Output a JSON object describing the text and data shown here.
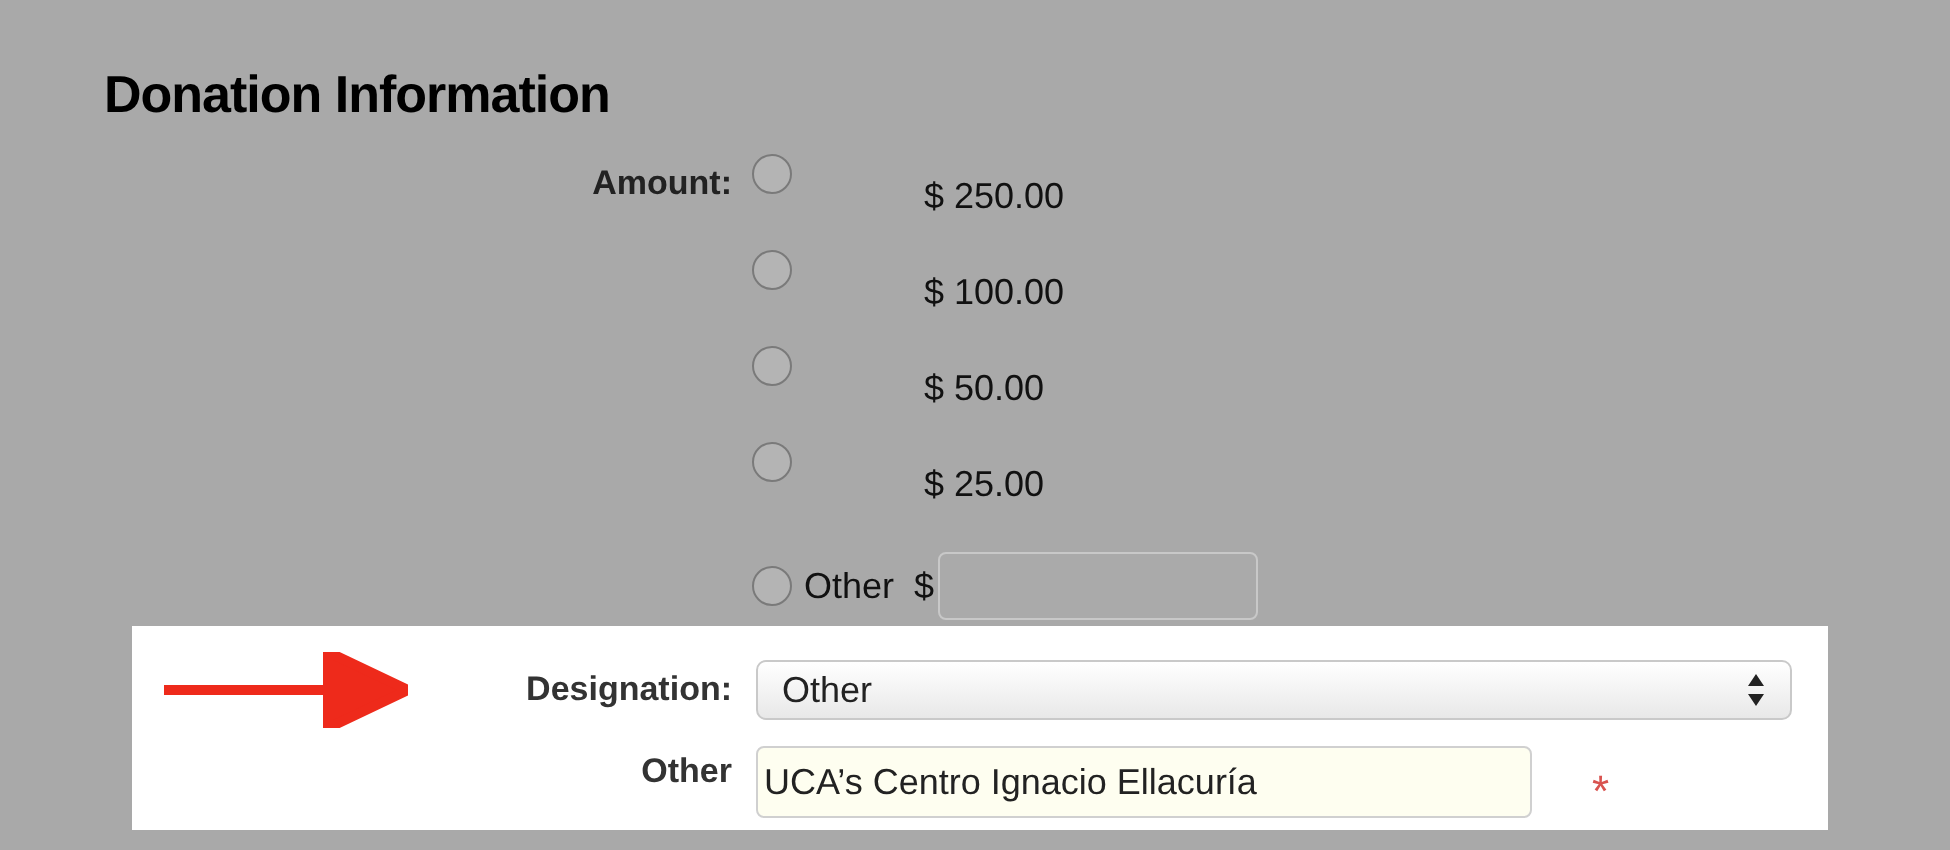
{
  "heading": "Donation Information",
  "amount": {
    "label": "Amount:",
    "options": [
      {
        "kind": "fixed",
        "label": "$ 250.00",
        "selected": false
      },
      {
        "kind": "fixed",
        "label": "$ 100.00",
        "selected": false
      },
      {
        "kind": "fixed",
        "label": "$ 50.00",
        "selected": false
      },
      {
        "kind": "fixed",
        "label": "$ 25.00",
        "selected": false
      },
      {
        "kind": "other",
        "label": "Other",
        "currency": "$",
        "selected": false
      }
    ]
  },
  "designation": {
    "label": "Designation:",
    "value": "Other"
  },
  "other": {
    "label": "Other",
    "value": "UCA’s Centro Ignacio Ellacuría",
    "required_mark": "*"
  }
}
